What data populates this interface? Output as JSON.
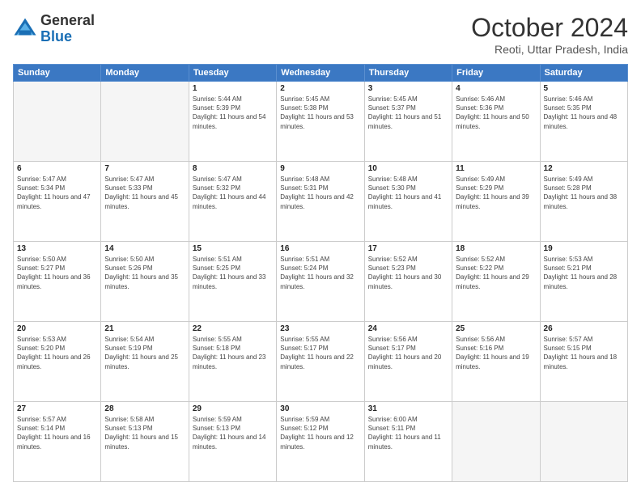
{
  "header": {
    "logo_line1": "General",
    "logo_line2": "Blue",
    "month": "October 2024",
    "location": "Reoti, Uttar Pradesh, India"
  },
  "weekdays": [
    "Sunday",
    "Monday",
    "Tuesday",
    "Wednesday",
    "Thursday",
    "Friday",
    "Saturday"
  ],
  "weeks": [
    [
      {
        "day": null
      },
      {
        "day": null
      },
      {
        "day": "1",
        "sunrise": "5:44 AM",
        "sunset": "5:39 PM",
        "daylight": "11 hours and 54 minutes."
      },
      {
        "day": "2",
        "sunrise": "5:45 AM",
        "sunset": "5:38 PM",
        "daylight": "11 hours and 53 minutes."
      },
      {
        "day": "3",
        "sunrise": "5:45 AM",
        "sunset": "5:37 PM",
        "daylight": "11 hours and 51 minutes."
      },
      {
        "day": "4",
        "sunrise": "5:46 AM",
        "sunset": "5:36 PM",
        "daylight": "11 hours and 50 minutes."
      },
      {
        "day": "5",
        "sunrise": "5:46 AM",
        "sunset": "5:35 PM",
        "daylight": "11 hours and 48 minutes."
      }
    ],
    [
      {
        "day": "6",
        "sunrise": "5:47 AM",
        "sunset": "5:34 PM",
        "daylight": "11 hours and 47 minutes."
      },
      {
        "day": "7",
        "sunrise": "5:47 AM",
        "sunset": "5:33 PM",
        "daylight": "11 hours and 45 minutes."
      },
      {
        "day": "8",
        "sunrise": "5:47 AM",
        "sunset": "5:32 PM",
        "daylight": "11 hours and 44 minutes."
      },
      {
        "day": "9",
        "sunrise": "5:48 AM",
        "sunset": "5:31 PM",
        "daylight": "11 hours and 42 minutes."
      },
      {
        "day": "10",
        "sunrise": "5:48 AM",
        "sunset": "5:30 PM",
        "daylight": "11 hours and 41 minutes."
      },
      {
        "day": "11",
        "sunrise": "5:49 AM",
        "sunset": "5:29 PM",
        "daylight": "11 hours and 39 minutes."
      },
      {
        "day": "12",
        "sunrise": "5:49 AM",
        "sunset": "5:28 PM",
        "daylight": "11 hours and 38 minutes."
      }
    ],
    [
      {
        "day": "13",
        "sunrise": "5:50 AM",
        "sunset": "5:27 PM",
        "daylight": "11 hours and 36 minutes."
      },
      {
        "day": "14",
        "sunrise": "5:50 AM",
        "sunset": "5:26 PM",
        "daylight": "11 hours and 35 minutes."
      },
      {
        "day": "15",
        "sunrise": "5:51 AM",
        "sunset": "5:25 PM",
        "daylight": "11 hours and 33 minutes."
      },
      {
        "day": "16",
        "sunrise": "5:51 AM",
        "sunset": "5:24 PM",
        "daylight": "11 hours and 32 minutes."
      },
      {
        "day": "17",
        "sunrise": "5:52 AM",
        "sunset": "5:23 PM",
        "daylight": "11 hours and 30 minutes."
      },
      {
        "day": "18",
        "sunrise": "5:52 AM",
        "sunset": "5:22 PM",
        "daylight": "11 hours and 29 minutes."
      },
      {
        "day": "19",
        "sunrise": "5:53 AM",
        "sunset": "5:21 PM",
        "daylight": "11 hours and 28 minutes."
      }
    ],
    [
      {
        "day": "20",
        "sunrise": "5:53 AM",
        "sunset": "5:20 PM",
        "daylight": "11 hours and 26 minutes."
      },
      {
        "day": "21",
        "sunrise": "5:54 AM",
        "sunset": "5:19 PM",
        "daylight": "11 hours and 25 minutes."
      },
      {
        "day": "22",
        "sunrise": "5:55 AM",
        "sunset": "5:18 PM",
        "daylight": "11 hours and 23 minutes."
      },
      {
        "day": "23",
        "sunrise": "5:55 AM",
        "sunset": "5:17 PM",
        "daylight": "11 hours and 22 minutes."
      },
      {
        "day": "24",
        "sunrise": "5:56 AM",
        "sunset": "5:17 PM",
        "daylight": "11 hours and 20 minutes."
      },
      {
        "day": "25",
        "sunrise": "5:56 AM",
        "sunset": "5:16 PM",
        "daylight": "11 hours and 19 minutes."
      },
      {
        "day": "26",
        "sunrise": "5:57 AM",
        "sunset": "5:15 PM",
        "daylight": "11 hours and 18 minutes."
      }
    ],
    [
      {
        "day": "27",
        "sunrise": "5:57 AM",
        "sunset": "5:14 PM",
        "daylight": "11 hours and 16 minutes."
      },
      {
        "day": "28",
        "sunrise": "5:58 AM",
        "sunset": "5:13 PM",
        "daylight": "11 hours and 15 minutes."
      },
      {
        "day": "29",
        "sunrise": "5:59 AM",
        "sunset": "5:13 PM",
        "daylight": "11 hours and 14 minutes."
      },
      {
        "day": "30",
        "sunrise": "5:59 AM",
        "sunset": "5:12 PM",
        "daylight": "11 hours and 12 minutes."
      },
      {
        "day": "31",
        "sunrise": "6:00 AM",
        "sunset": "5:11 PM",
        "daylight": "11 hours and 11 minutes."
      },
      {
        "day": null
      },
      {
        "day": null
      }
    ]
  ]
}
